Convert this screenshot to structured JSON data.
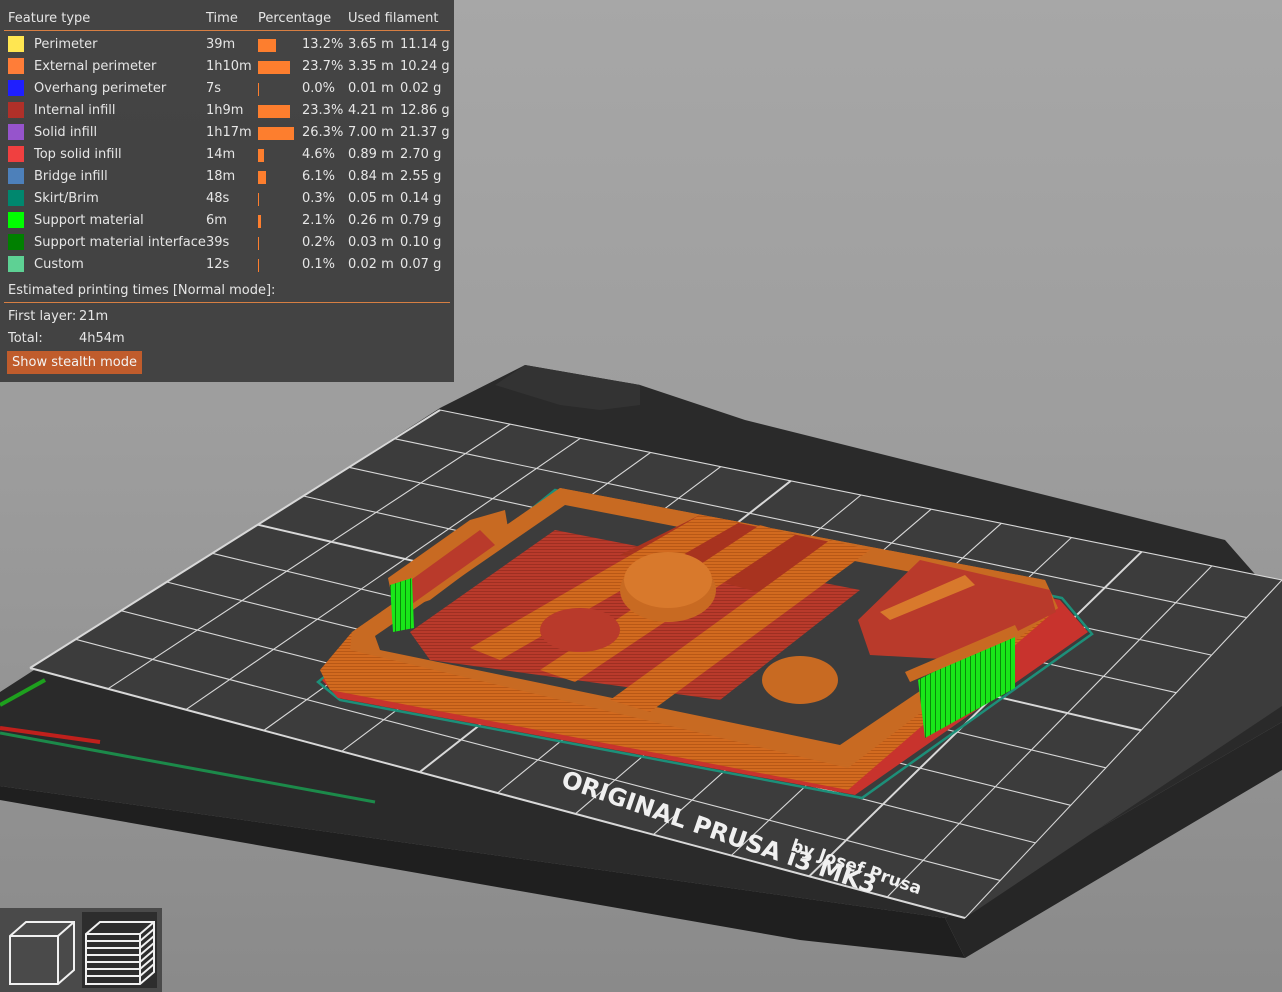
{
  "legend": {
    "headers": {
      "feature_type": "Feature type",
      "time": "Time",
      "percentage": "Percentage",
      "used_filament": "Used filament"
    },
    "rows": [
      {
        "name": "Perimeter",
        "color": "#ffe651",
        "time": "39m",
        "percentage": "13.2%",
        "bar_fraction": 0.132,
        "length": "3.65 m",
        "weight": "11.14 g"
      },
      {
        "name": "External perimeter",
        "color": "#ff7d38",
        "time": "1h10m",
        "percentage": "23.7%",
        "bar_fraction": 0.237,
        "length": "3.35 m",
        "weight": "10.24 g"
      },
      {
        "name": "Overhang perimeter",
        "color": "#1f1fff",
        "time": "7s",
        "percentage": "0.0%",
        "bar_fraction": 0.0,
        "length": "0.01 m",
        "weight": "0.02 g"
      },
      {
        "name": "Internal infill",
        "color": "#b03029",
        "time": "1h9m",
        "percentage": "23.3%",
        "bar_fraction": 0.233,
        "length": "4.21 m",
        "weight": "12.86 g"
      },
      {
        "name": "Solid infill",
        "color": "#9654cc",
        "time": "1h17m",
        "percentage": "26.3%",
        "bar_fraction": 0.263,
        "length": "7.00 m",
        "weight": "21.37 g"
      },
      {
        "name": "Top solid infill",
        "color": "#f04040",
        "time": "14m",
        "percentage": "4.6%",
        "bar_fraction": 0.046,
        "length": "0.89 m",
        "weight": "2.70 g"
      },
      {
        "name": "Bridge infill",
        "color": "#4d80ba",
        "time": "18m",
        "percentage": "6.1%",
        "bar_fraction": 0.061,
        "length": "0.84 m",
        "weight": "2.55 g"
      },
      {
        "name": "Skirt/Brim",
        "color": "#00876e",
        "time": "48s",
        "percentage": "0.3%",
        "bar_fraction": 0.003,
        "length": "0.05 m",
        "weight": "0.14 g"
      },
      {
        "name": "Support material",
        "color": "#00ff00",
        "time": "6m",
        "percentage": "2.1%",
        "bar_fraction": 0.021,
        "length": "0.26 m",
        "weight": "0.79 g"
      },
      {
        "name": "Support material interface",
        "color": "#008000",
        "time": "39s",
        "percentage": "0.2%",
        "bar_fraction": 0.002,
        "length": "0.03 m",
        "weight": "0.10 g"
      },
      {
        "name": "Custom",
        "color": "#5ed194",
        "time": "12s",
        "percentage": "0.1%",
        "bar_fraction": 0.001,
        "length": "0.02 m",
        "weight": "0.07 g"
      }
    ],
    "estimated_title": "Estimated printing times [Normal mode]:",
    "first_layer_label": "First layer:",
    "first_layer_value": "21m",
    "total_label": "Total:",
    "total_value": "4h54m",
    "stealth_button": "Show stealth mode"
  },
  "bed": {
    "text_line1": "ORIGINAL PRUSA i3 MK3",
    "text_line2": "by Josef Prusa"
  },
  "view_toggle": {
    "items": [
      {
        "name": "3d-view-icon",
        "active": false
      },
      {
        "name": "preview-layers-icon",
        "active": true
      }
    ]
  },
  "colors": {
    "accent": "#d77f43",
    "button": "#c05c2c",
    "bar": "#fd7e2e",
    "external_perimeter": "#d4661f",
    "infill": "#b83a2a",
    "support": "#00ff00"
  }
}
